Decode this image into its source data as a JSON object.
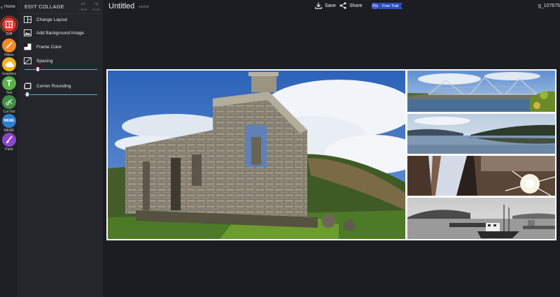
{
  "rail": {
    "home_label": "Home",
    "tools": [
      {
        "label": "Edit",
        "color": "#e23b2d"
      },
      {
        "label": "Filters",
        "color": "#f08a24"
      },
      {
        "label": "Graphics",
        "color": "#f2b51e"
      },
      {
        "label": "Text",
        "color": "#59b34a"
      },
      {
        "label": "Cut Out",
        "color": "#3f8f43"
      },
      {
        "label": "MEME",
        "color": "#2f7fd0"
      },
      {
        "label": "Paint",
        "color": "#8b45c9"
      }
    ],
    "meme_icon_text": "MEME"
  },
  "panel": {
    "title": "EDIT COLLAGE",
    "undo_label": "Undo",
    "redo_label": "Redo",
    "options": {
      "change_layout": "Change Layout",
      "add_background_image": "Add Background Image",
      "frame_color": "Frame Color",
      "spacing": "Spacing",
      "corner_rounding": "Corner Rounding"
    },
    "spacing_value": 0.17,
    "corner_rounding_value": 0.02,
    "accent": "#4dbcc4"
  },
  "topbar": {
    "title": "Untitled",
    "status": "saving",
    "save_label": "Save",
    "share_label": "Share",
    "pro_badge": "Pro",
    "free_trial_label": "Free Trial",
    "user_id": "g_107675"
  }
}
